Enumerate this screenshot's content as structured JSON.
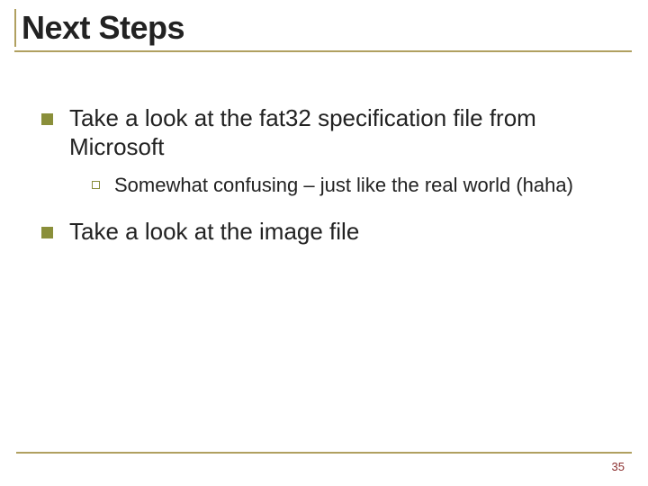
{
  "title": "Next Steps",
  "bullets": [
    {
      "text": "Take a look at the fat32 specification file from Microsoft",
      "sub": [
        {
          "text": "Somewhat confusing – just like the real world (haha)"
        }
      ]
    },
    {
      "text": "Take a look at the image file"
    }
  ],
  "pageNumber": "35"
}
